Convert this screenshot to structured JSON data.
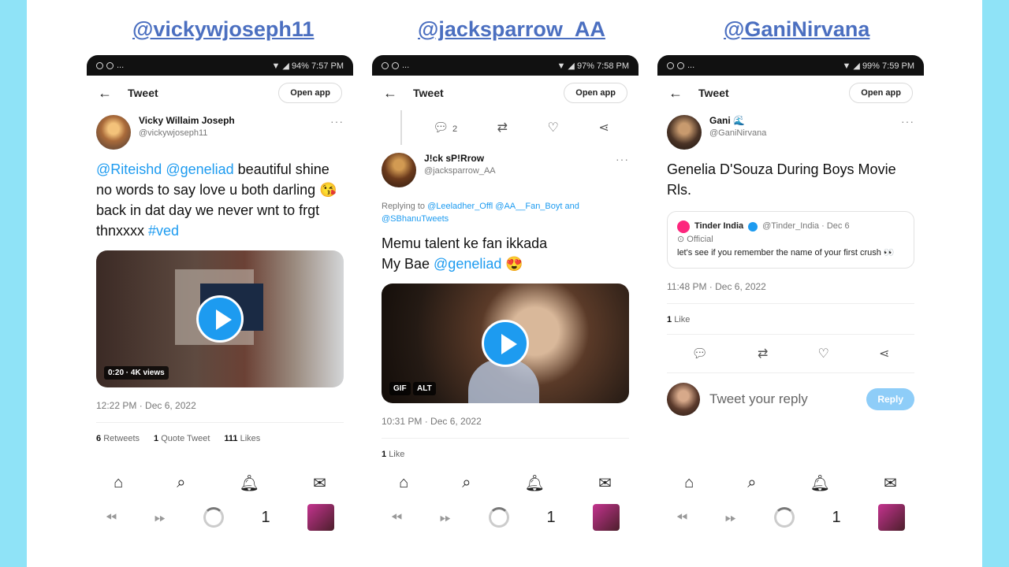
{
  "headers": [
    "@vickywjoseph11",
    "@jacksparrow_AA",
    "@GaniNirvana"
  ],
  "common": {
    "topbar_title": "Tweet",
    "open_app": "Open app",
    "nav_badge": "1",
    "accent_color": "#1d9bf0"
  },
  "phone1": {
    "status_time": "7:57 PM",
    "status_battery": "94%",
    "author_name": "Vicky Willaim Joseph",
    "author_handle": "@vickywjoseph11",
    "text_mention1": "@Riteishd",
    "text_mention2": "@geneliad",
    "text_body": " beautiful shine no words to say love u both darling 😘 back in dat day we never wnt to frgt thnxxxx ",
    "text_hashtag": "#ved",
    "video_badge": "0:20 · 4K views",
    "timestamp": "12:22 PM · Dec 6, 2022",
    "retweets_count": "6",
    "retweets_label": "Retweets",
    "quote_count": "1",
    "quote_label": "Quote Tweet",
    "likes_count": "111",
    "likes_label": "Likes"
  },
  "phone2": {
    "status_time": "7:58 PM",
    "status_battery": "97%",
    "reply_count": "2",
    "author_name": "J!ck sP!Rrow",
    "author_handle": "@jacksparrow_AA",
    "replying_prefix": "Replying to ",
    "replying_users": "@Leeladher_Offl @AA__Fan_Boyt and @SBhanuTweets",
    "text_line1": "Memu talent ke fan ikkada",
    "text_line2_prefix": "My Bae ",
    "text_mention": "@geneliad",
    "text_emoji": " 😍",
    "gif_badge": "GIF",
    "alt_badge": "ALT",
    "timestamp": "10:31 PM · Dec 6, 2022",
    "likes_count": "1",
    "likes_label": "Like"
  },
  "phone3": {
    "status_time": "7:59 PM",
    "status_battery": "99%",
    "author_name": "Gani 🌊",
    "author_handle": "@GaniNirvana",
    "text": "Genelia D'Souza During Boys Movie Rls.",
    "quote_name": "Tinder India",
    "quote_handle": "@Tinder_India · Dec 6",
    "quote_official": "Official",
    "quote_text": "let's see if you remember the name of your first crush 👀",
    "timestamp": "11:48 PM · Dec 6, 2022",
    "likes_count": "1",
    "likes_label": "Like",
    "reply_placeholder": "Tweet your reply",
    "reply_button": "Reply"
  }
}
